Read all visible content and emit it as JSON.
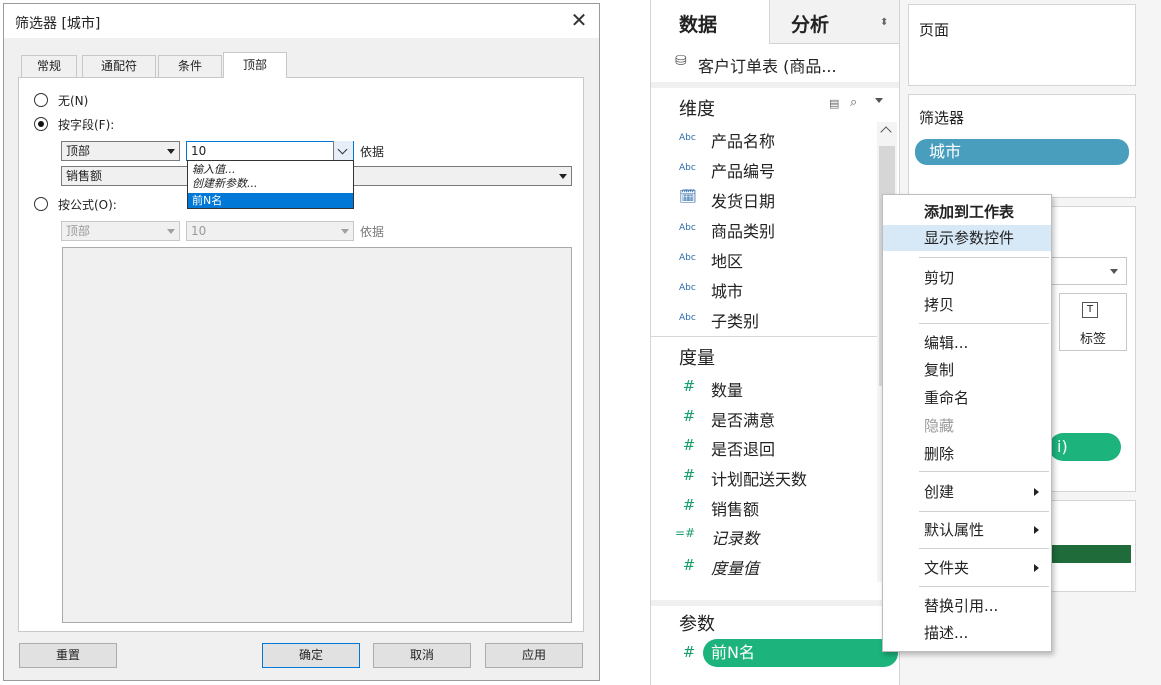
{
  "dialog": {
    "title": "筛选器 [城市]",
    "close": "✕",
    "tabs": [
      "常规",
      "通配符",
      "条件",
      "顶部"
    ],
    "options": {
      "none": "无(N)",
      "by_field": "按字段(F):",
      "by_formula": "按公式(O):"
    },
    "by_field": {
      "position": "顶部",
      "value": "10",
      "basis_label": "依据",
      "field": "销售额",
      "dropdown_items": [
        "输入值...",
        "创建新参数...",
        "前N名"
      ]
    },
    "by_formula": {
      "position": "顶部",
      "value": "10",
      "basis_label": "依据"
    },
    "buttons": {
      "reset": "重置",
      "ok": "确定",
      "cancel": "取消",
      "apply": "应用"
    }
  },
  "workspace": {
    "tabs": {
      "data": "数据",
      "analysis": "分析"
    },
    "datasource": "客户订单表 (商品...",
    "dimensions_header": "维度",
    "dimensions": [
      {
        "type": "Abc",
        "name": "产品名称"
      },
      {
        "type": "Abc",
        "name": "产品编号"
      },
      {
        "type": "date",
        "name": "发货日期"
      },
      {
        "type": "Abc",
        "name": "商品类别"
      },
      {
        "type": "Abc",
        "name": "地区"
      },
      {
        "type": "Abc",
        "name": "城市"
      },
      {
        "type": "Abc",
        "name": "子类别"
      }
    ],
    "measures_header": "度量",
    "measures": [
      {
        "type": "#",
        "name": "数量"
      },
      {
        "type": "#",
        "name": "是否满意"
      },
      {
        "type": "#",
        "name": "是否退回"
      },
      {
        "type": "#",
        "name": "计划配送天数"
      },
      {
        "type": "#",
        "name": "销售额"
      },
      {
        "type": "=#",
        "name": "记录数"
      },
      {
        "type": "#",
        "name": "度量值"
      }
    ],
    "parameters_header": "参数",
    "parameter": "前N名",
    "pages_label": "页面",
    "filters_label": "筛选器",
    "filter_pill": "城市",
    "marks_label_text": "标签",
    "partial_pill_text": "i)",
    "context_menu": [
      {
        "label": "添加到工作表",
        "bold": true
      },
      {
        "label": "显示参数控件",
        "highlight": true
      },
      {
        "label": "剪切"
      },
      {
        "label": "拷贝"
      },
      {
        "label": "编辑..."
      },
      {
        "label": "复制"
      },
      {
        "label": "重命名"
      },
      {
        "label": "隐藏",
        "disabled": true
      },
      {
        "label": "删除"
      },
      {
        "label": "创建",
        "submenu": true
      },
      {
        "label": "默认属性",
        "submenu": true
      },
      {
        "label": "文件夹",
        "submenu": true
      },
      {
        "label": "替换引用..."
      },
      {
        "label": "描述..."
      }
    ],
    "colors": {
      "filter_pill": "#4a9ebd",
      "param_pill": "#1db37d",
      "dark_bar": "#1f6b3a"
    }
  }
}
